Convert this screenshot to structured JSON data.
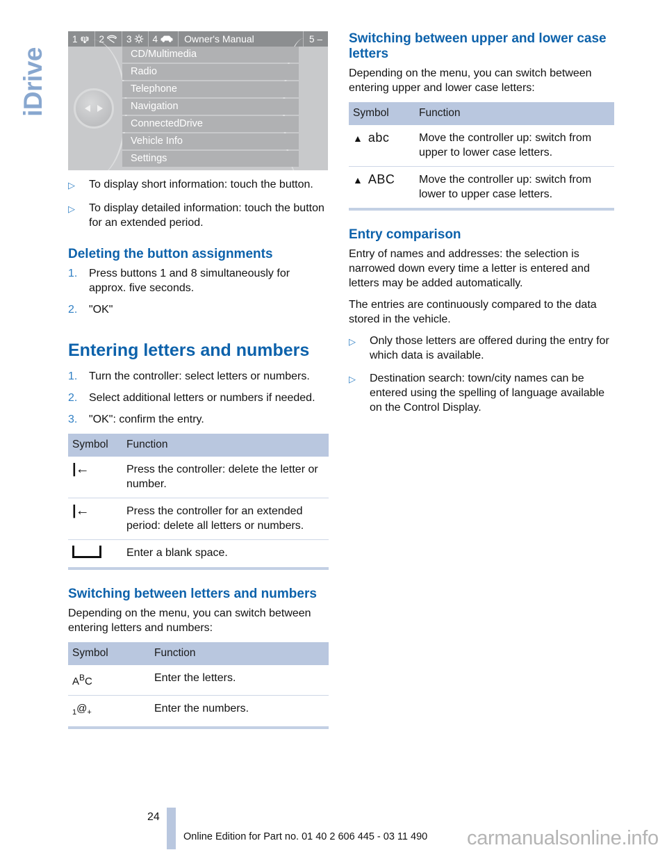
{
  "chapter_tab": "iDrive",
  "idrive_screen": {
    "status_bar": {
      "items": [
        {
          "number": "1",
          "icon": "radio-waves-icon"
        },
        {
          "number": "2",
          "icon": "telephone-icon"
        },
        {
          "number": "3",
          "icon": "gear-icon"
        },
        {
          "number": "4",
          "icon": "car-icon"
        }
      ],
      "title": "Owner's Manual",
      "right_number": "5",
      "right_dash": "–"
    },
    "menu_items": [
      "CD/Multimedia",
      "Radio",
      "Telephone",
      "Navigation",
      "ConnectedDrive",
      "Vehicle Info",
      "Settings"
    ]
  },
  "left_column": {
    "touch_bullets": [
      {
        "marker": "▷",
        "text": "To display short information: touch the button."
      },
      {
        "marker": "▷",
        "text": "To display detailed information: touch the button for an extended period."
      }
    ],
    "deleting_heading": "Deleting the button assignments",
    "deleting_steps": [
      {
        "num": "1.",
        "text": "Press buttons 1 and 8 simultaneously for approx. five seconds."
      },
      {
        "num": "2.",
        "text": "\"OK\""
      }
    ],
    "entering_heading": "Entering letters and numbers",
    "entering_steps": [
      {
        "num": "1.",
        "text": "Turn the controller: select letters or numbers."
      },
      {
        "num": "2.",
        "text": "Select additional letters or numbers if needed."
      },
      {
        "num": "3.",
        "text": "\"OK\": confirm the entry."
      }
    ],
    "entering_table": {
      "headers": [
        "Symbol",
        "Function"
      ],
      "rows": [
        {
          "symbol": "|←",
          "symbol_name": "backspace-icon",
          "function": "Press the controller: delete the letter or number."
        },
        {
          "symbol": "|←",
          "symbol_name": "backspace-icon",
          "function": "Press the controller for an extended period: delete all letters or numbers."
        },
        {
          "symbol": "␣",
          "symbol_name": "blank-space-icon",
          "function": "Enter a blank space."
        }
      ]
    },
    "switching_heading": "Switching between letters and numbers",
    "switching_intro": "Depending on the menu, you can switch between entering letters and numbers:",
    "switching_table": {
      "headers": [
        "Symbol",
        "Function"
      ],
      "rows": [
        {
          "symbol_a": "A",
          "symbol_b": "B",
          "symbol_c": "C",
          "symbol_name": "abc-letters-icon",
          "function": "Enter the letters."
        },
        {
          "symbol_1": "1",
          "symbol_at": "@",
          "symbol_plus": "+",
          "symbol_name": "numbers-symbols-icon",
          "function": "Enter the numbers."
        }
      ]
    }
  },
  "right_column": {
    "case_heading": "Switching between upper and lower case letters",
    "case_intro": "Depending on the menu, you can switch between entering upper and lower case letters:",
    "case_table": {
      "headers": [
        "Symbol",
        "Function"
      ],
      "rows": [
        {
          "arrow": "▲",
          "label": "abc",
          "symbol_name": "up-arrow-lowercase-icon",
          "function": "Move the controller up: switch from upper to lower case letters."
        },
        {
          "arrow": "▲",
          "label": "ABC",
          "symbol_name": "up-arrow-uppercase-icon",
          "function": "Move the controller up: switch from lower to upper case letters."
        }
      ]
    },
    "entry_heading": "Entry comparison",
    "entry_p1": "Entry of names and addresses: the selection is narrowed down every time a letter is entered and letters may be added automatically.",
    "entry_p2": "The entries are continuously compared to the data stored in the vehicle.",
    "entry_bullets": [
      {
        "marker": "▷",
        "text": "Only those letters are offered during the entry for which data is available."
      },
      {
        "marker": "▷",
        "text": "Destination search: town/city names can be entered using the spelling of language available on the Control Display."
      }
    ]
  },
  "footer": {
    "page_number": "24",
    "text": "Online Edition for Part no. 01 40 2 606 445 - 03 11 490",
    "watermark": "carmanualsonline.info"
  },
  "colors": {
    "heading_blue": "#0d62ab",
    "tab_blue": "#88a7cf",
    "table_header_bg": "#b9c7df",
    "marker_blue": "#2f7fc4"
  }
}
